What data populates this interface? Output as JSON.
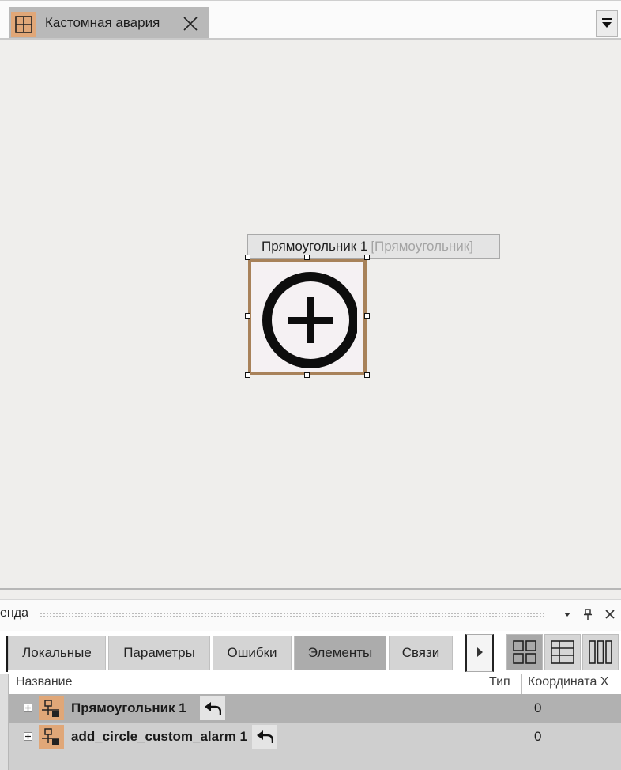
{
  "document_tab": {
    "title": "Кастомная авария",
    "icon": "grid-icon",
    "close_icon": "close-icon"
  },
  "strip_menu_icon": "dropdown-menu-icon",
  "canvas": {
    "selection_label": {
      "name": "Прямоугольник 1",
      "type": "[Прямоугольник]"
    },
    "shape_image": "add-circle-icon",
    "shape_border_color": "#a8825a"
  },
  "panel": {
    "title": "енда",
    "buttons": [
      "chevron-down-icon",
      "pin-icon",
      "close-icon"
    ],
    "tabs": [
      {
        "label": "Локальные",
        "active": false
      },
      {
        "label": "Параметры",
        "active": false
      },
      {
        "label": "Ошибки",
        "active": false
      },
      {
        "label": "Элементы",
        "active": true
      },
      {
        "label": "Связи",
        "active": false
      }
    ],
    "view_buttons": [
      "tiles-view-icon",
      "table-view-icon",
      "columns-view-icon"
    ]
  },
  "grid": {
    "columns": [
      "Название",
      "Тип",
      "Координата X"
    ],
    "rows": [
      {
        "name": "Прямоугольник 1",
        "type": "",
        "x": "0",
        "selected": true
      },
      {
        "name": "add_circle_custom_alarm 1",
        "type": "",
        "x": "0",
        "selected": false
      }
    ]
  },
  "colors": {
    "accent_orange": "#e0a778",
    "active_tab": "#acacac",
    "selected_row": "#b1b1b1"
  }
}
